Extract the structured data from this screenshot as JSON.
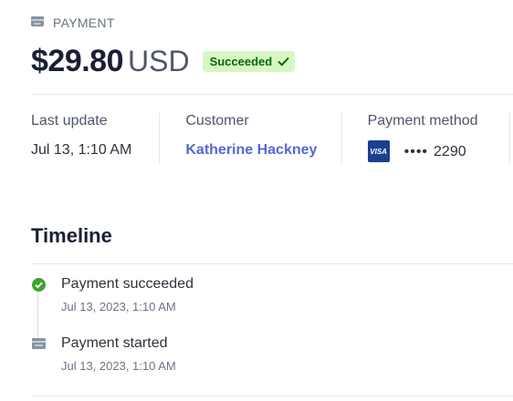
{
  "header": {
    "section_label": "PAYMENT",
    "amount": "$29.80",
    "currency": "USD",
    "status": "Succeeded"
  },
  "details": {
    "last_update": {
      "label": "Last update",
      "value": "Jul 13, 1:10 AM"
    },
    "customer": {
      "label": "Customer",
      "value": "Katherine Hackney"
    },
    "payment_method": {
      "label": "Payment method",
      "brand": "VISA",
      "dots": "••••",
      "last4": "2290"
    }
  },
  "timeline": {
    "title": "Timeline",
    "events": [
      {
        "title": "Payment succeeded",
        "time": "Jul 13, 2023, 1:10 AM",
        "icon": "check-circle-icon"
      },
      {
        "title": "Payment started",
        "time": "Jul 13, 2023, 1:10 AM",
        "icon": "wallet-icon"
      }
    ]
  },
  "colors": {
    "success_bg": "#d7f7c2",
    "success_text": "#05690d",
    "link": "#5469d4",
    "visa": "#1a3f8f"
  }
}
